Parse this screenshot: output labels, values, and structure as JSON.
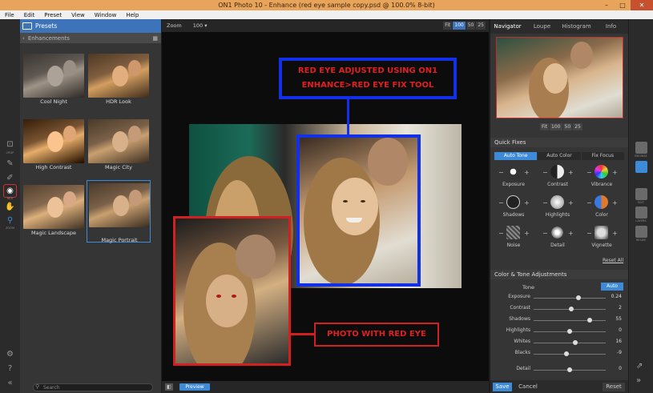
{
  "window": {
    "title": "ON1 Photo 10 - Enhance (red eye sample copy.psd @ 100.0% 8-bit)",
    "min": "–",
    "max": "□",
    "close": "✕"
  },
  "menu": [
    "File",
    "Edit",
    "Preset",
    "View",
    "Window",
    "Help"
  ],
  "presets": {
    "header": "Presets",
    "category": "Enhancements",
    "items": [
      {
        "label": "Cool Night"
      },
      {
        "label": "HDR Look"
      },
      {
        "label": "High Contrast"
      },
      {
        "label": "Magic City"
      },
      {
        "label": "Magic Landscape"
      },
      {
        "label": "Magic Portrait"
      }
    ],
    "search_placeholder": "Search"
  },
  "left_tools": [
    {
      "icon": "crop-icon",
      "label": "CROP"
    },
    {
      "icon": "brush-icon",
      "label": ""
    },
    {
      "icon": "retouch-icon",
      "label": ""
    },
    {
      "icon": "red-eye-icon",
      "label": "RED"
    },
    {
      "icon": "hand-icon",
      "label": ""
    },
    {
      "icon": "zoom-icon",
      "label": "ZOOM"
    }
  ],
  "zoom": {
    "label": "Zoom",
    "value": "100",
    "buttons": [
      "Fit",
      "100",
      "50",
      "25"
    ],
    "active": "100"
  },
  "annotations": {
    "top_line1": "RED EYE ADJUSTED USING ON1",
    "top_line2": "ENHANCE>RED EYE FIX TOOL",
    "bottom": "PHOTO WITH RED EYE"
  },
  "preview_label": "Preview",
  "navigator": {
    "tabs": [
      "Navigator",
      "Loupe",
      "Histogram",
      "Info"
    ],
    "active_tab": "Navigator",
    "zoom_buttons": [
      "Fit",
      "100",
      "50",
      "25"
    ]
  },
  "quick_fixes": {
    "title": "Quick Fixes",
    "tabs": [
      "Auto Tone",
      "Auto Color",
      "Fix Focus"
    ],
    "active_tab": "Auto Tone",
    "items": [
      "Exposure",
      "Contrast",
      "Vibrance",
      "Shadows",
      "Highlights",
      "Color",
      "Noise",
      "Detail",
      "Vignette"
    ],
    "reset_all": "Reset All"
  },
  "color_tone": {
    "title": "Color & Tone Adjustments",
    "tone_label": "Tone",
    "auto_label": "Auto",
    "sliders": [
      {
        "name": "Exposure",
        "value": "0.24",
        "pos": 0.62
      },
      {
        "name": "Contrast",
        "value": "2",
        "pos": 0.52
      },
      {
        "name": "Shadows",
        "value": "55",
        "pos": 0.78
      },
      {
        "name": "Highlights",
        "value": "0",
        "pos": 0.5
      },
      {
        "name": "Whites",
        "value": "16",
        "pos": 0.58
      },
      {
        "name": "Blacks",
        "value": "-9",
        "pos": 0.45
      }
    ],
    "detail": {
      "name": "Detail",
      "value": "0",
      "pos": 0.5
    }
  },
  "footer": {
    "save": "Save",
    "cancel": "Cancel",
    "reset": "Reset"
  },
  "right_tools": [
    {
      "icon": "browse-icon",
      "label": "BROWSE"
    },
    {
      "icon": "develop-icon",
      "label": ""
    },
    {
      "icon": "edit-icon",
      "label": "EDIT"
    },
    {
      "icon": "layers-icon",
      "label": "LAYERS"
    },
    {
      "icon": "resize-icon",
      "label": "RESIZE"
    }
  ],
  "colors": {
    "accent": "#3d8ad8",
    "annotation_red": "#e02020",
    "annotation_blue": "#1230e8"
  }
}
